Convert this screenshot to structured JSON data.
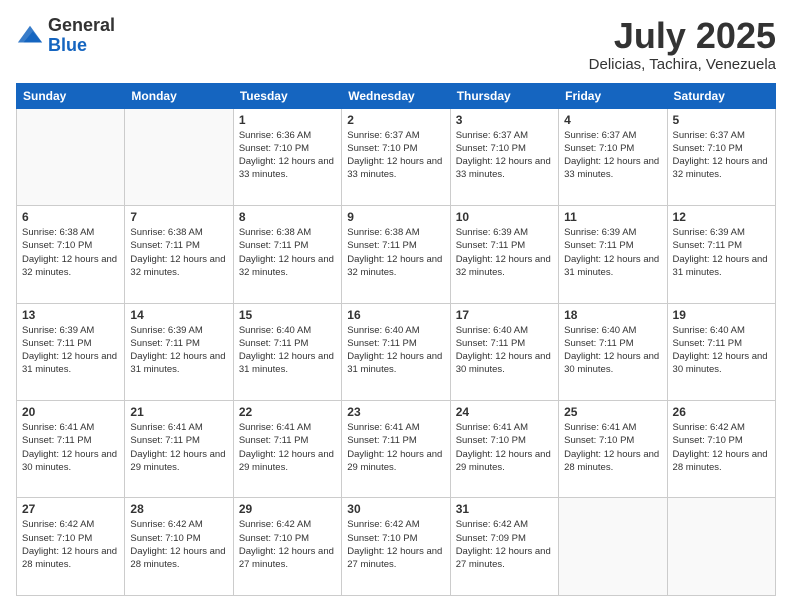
{
  "header": {
    "logo_general": "General",
    "logo_blue": "Blue",
    "month_title": "July 2025",
    "location": "Delicias, Tachira, Venezuela"
  },
  "weekdays": [
    "Sunday",
    "Monday",
    "Tuesday",
    "Wednesday",
    "Thursday",
    "Friday",
    "Saturday"
  ],
  "weeks": [
    [
      {
        "day": "",
        "info": ""
      },
      {
        "day": "",
        "info": ""
      },
      {
        "day": "1",
        "sunrise": "Sunrise: 6:36 AM",
        "sunset": "Sunset: 7:10 PM",
        "daylight": "Daylight: 12 hours and 33 minutes."
      },
      {
        "day": "2",
        "sunrise": "Sunrise: 6:37 AM",
        "sunset": "Sunset: 7:10 PM",
        "daylight": "Daylight: 12 hours and 33 minutes."
      },
      {
        "day": "3",
        "sunrise": "Sunrise: 6:37 AM",
        "sunset": "Sunset: 7:10 PM",
        "daylight": "Daylight: 12 hours and 33 minutes."
      },
      {
        "day": "4",
        "sunrise": "Sunrise: 6:37 AM",
        "sunset": "Sunset: 7:10 PM",
        "daylight": "Daylight: 12 hours and 33 minutes."
      },
      {
        "day": "5",
        "sunrise": "Sunrise: 6:37 AM",
        "sunset": "Sunset: 7:10 PM",
        "daylight": "Daylight: 12 hours and 32 minutes."
      }
    ],
    [
      {
        "day": "6",
        "sunrise": "Sunrise: 6:38 AM",
        "sunset": "Sunset: 7:10 PM",
        "daylight": "Daylight: 12 hours and 32 minutes."
      },
      {
        "day": "7",
        "sunrise": "Sunrise: 6:38 AM",
        "sunset": "Sunset: 7:11 PM",
        "daylight": "Daylight: 12 hours and 32 minutes."
      },
      {
        "day": "8",
        "sunrise": "Sunrise: 6:38 AM",
        "sunset": "Sunset: 7:11 PM",
        "daylight": "Daylight: 12 hours and 32 minutes."
      },
      {
        "day": "9",
        "sunrise": "Sunrise: 6:38 AM",
        "sunset": "Sunset: 7:11 PM",
        "daylight": "Daylight: 12 hours and 32 minutes."
      },
      {
        "day": "10",
        "sunrise": "Sunrise: 6:39 AM",
        "sunset": "Sunset: 7:11 PM",
        "daylight": "Daylight: 12 hours and 32 minutes."
      },
      {
        "day": "11",
        "sunrise": "Sunrise: 6:39 AM",
        "sunset": "Sunset: 7:11 PM",
        "daylight": "Daylight: 12 hours and 31 minutes."
      },
      {
        "day": "12",
        "sunrise": "Sunrise: 6:39 AM",
        "sunset": "Sunset: 7:11 PM",
        "daylight": "Daylight: 12 hours and 31 minutes."
      }
    ],
    [
      {
        "day": "13",
        "sunrise": "Sunrise: 6:39 AM",
        "sunset": "Sunset: 7:11 PM",
        "daylight": "Daylight: 12 hours and 31 minutes."
      },
      {
        "day": "14",
        "sunrise": "Sunrise: 6:39 AM",
        "sunset": "Sunset: 7:11 PM",
        "daylight": "Daylight: 12 hours and 31 minutes."
      },
      {
        "day": "15",
        "sunrise": "Sunrise: 6:40 AM",
        "sunset": "Sunset: 7:11 PM",
        "daylight": "Daylight: 12 hours and 31 minutes."
      },
      {
        "day": "16",
        "sunrise": "Sunrise: 6:40 AM",
        "sunset": "Sunset: 7:11 PM",
        "daylight": "Daylight: 12 hours and 31 minutes."
      },
      {
        "day": "17",
        "sunrise": "Sunrise: 6:40 AM",
        "sunset": "Sunset: 7:11 PM",
        "daylight": "Daylight: 12 hours and 30 minutes."
      },
      {
        "day": "18",
        "sunrise": "Sunrise: 6:40 AM",
        "sunset": "Sunset: 7:11 PM",
        "daylight": "Daylight: 12 hours and 30 minutes."
      },
      {
        "day": "19",
        "sunrise": "Sunrise: 6:40 AM",
        "sunset": "Sunset: 7:11 PM",
        "daylight": "Daylight: 12 hours and 30 minutes."
      }
    ],
    [
      {
        "day": "20",
        "sunrise": "Sunrise: 6:41 AM",
        "sunset": "Sunset: 7:11 PM",
        "daylight": "Daylight: 12 hours and 30 minutes."
      },
      {
        "day": "21",
        "sunrise": "Sunrise: 6:41 AM",
        "sunset": "Sunset: 7:11 PM",
        "daylight": "Daylight: 12 hours and 29 minutes."
      },
      {
        "day": "22",
        "sunrise": "Sunrise: 6:41 AM",
        "sunset": "Sunset: 7:11 PM",
        "daylight": "Daylight: 12 hours and 29 minutes."
      },
      {
        "day": "23",
        "sunrise": "Sunrise: 6:41 AM",
        "sunset": "Sunset: 7:11 PM",
        "daylight": "Daylight: 12 hours and 29 minutes."
      },
      {
        "day": "24",
        "sunrise": "Sunrise: 6:41 AM",
        "sunset": "Sunset: 7:10 PM",
        "daylight": "Daylight: 12 hours and 29 minutes."
      },
      {
        "day": "25",
        "sunrise": "Sunrise: 6:41 AM",
        "sunset": "Sunset: 7:10 PM",
        "daylight": "Daylight: 12 hours and 28 minutes."
      },
      {
        "day": "26",
        "sunrise": "Sunrise: 6:42 AM",
        "sunset": "Sunset: 7:10 PM",
        "daylight": "Daylight: 12 hours and 28 minutes."
      }
    ],
    [
      {
        "day": "27",
        "sunrise": "Sunrise: 6:42 AM",
        "sunset": "Sunset: 7:10 PM",
        "daylight": "Daylight: 12 hours and 28 minutes."
      },
      {
        "day": "28",
        "sunrise": "Sunrise: 6:42 AM",
        "sunset": "Sunset: 7:10 PM",
        "daylight": "Daylight: 12 hours and 28 minutes."
      },
      {
        "day": "29",
        "sunrise": "Sunrise: 6:42 AM",
        "sunset": "Sunset: 7:10 PM",
        "daylight": "Daylight: 12 hours and 27 minutes."
      },
      {
        "day": "30",
        "sunrise": "Sunrise: 6:42 AM",
        "sunset": "Sunset: 7:10 PM",
        "daylight": "Daylight: 12 hours and 27 minutes."
      },
      {
        "day": "31",
        "sunrise": "Sunrise: 6:42 AM",
        "sunset": "Sunset: 7:09 PM",
        "daylight": "Daylight: 12 hours and 27 minutes."
      },
      {
        "day": "",
        "info": ""
      },
      {
        "day": "",
        "info": ""
      }
    ]
  ]
}
